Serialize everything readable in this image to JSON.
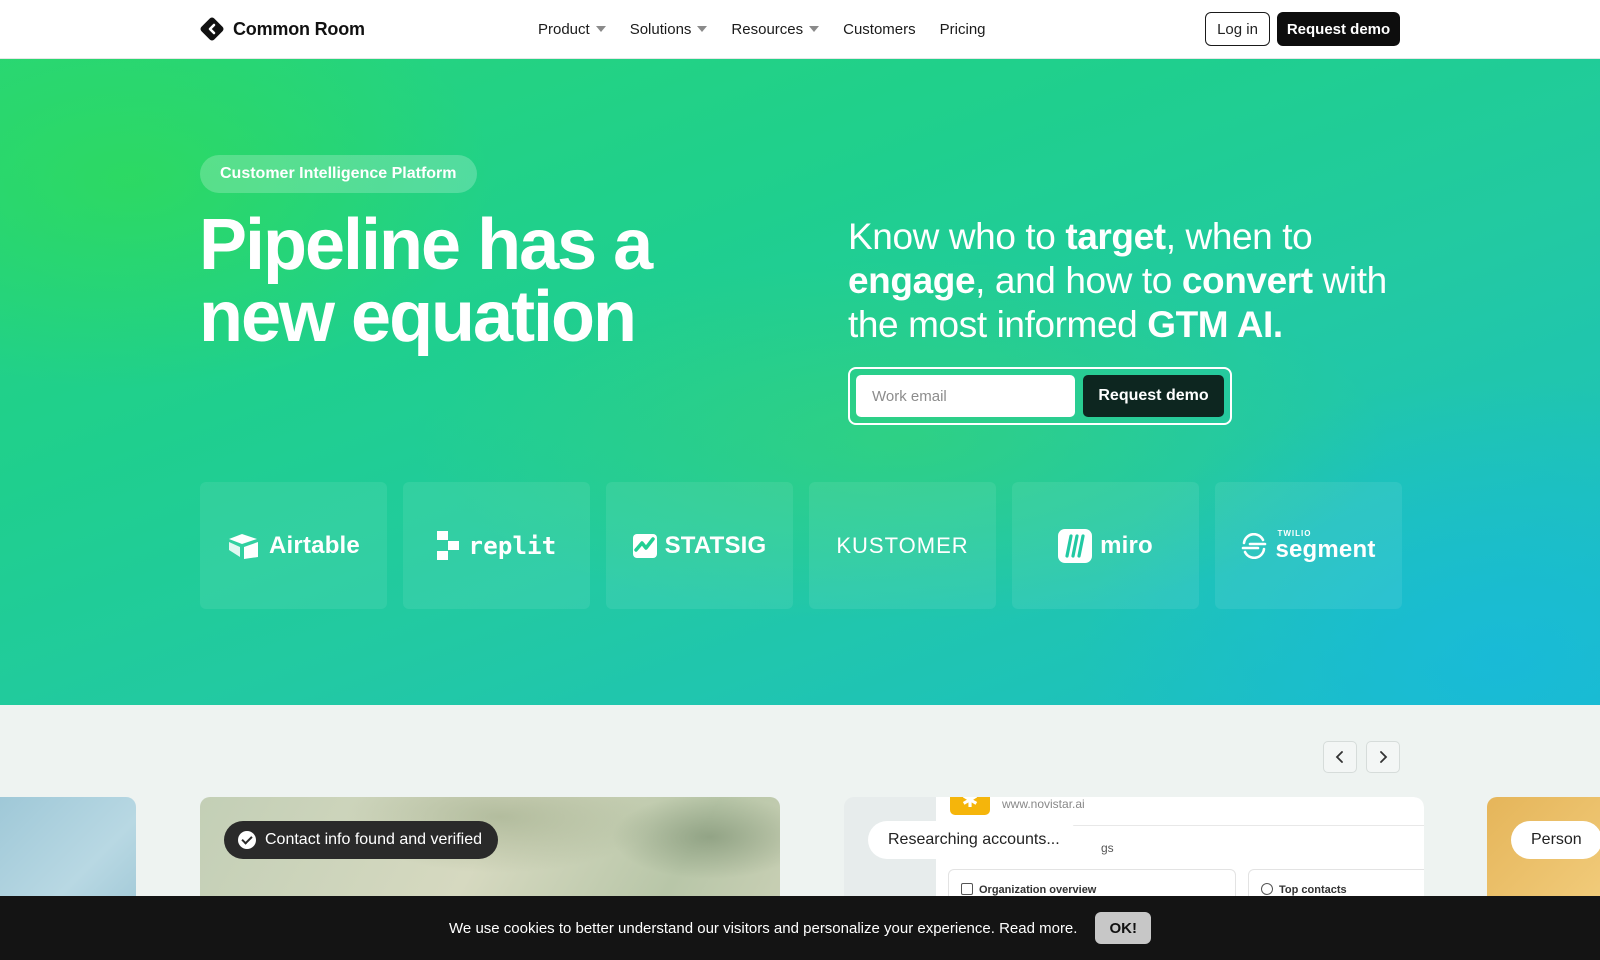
{
  "nav": {
    "brand": "Common Room",
    "items": [
      {
        "label": "Product",
        "has_caret": true
      },
      {
        "label": "Solutions",
        "has_caret": true
      },
      {
        "label": "Resources",
        "has_caret": true
      },
      {
        "label": "Customers",
        "has_caret": false
      },
      {
        "label": "Pricing",
        "has_caret": false
      }
    ],
    "login_label": "Log in",
    "demo_label": "Request demo"
  },
  "hero": {
    "pill": "Customer Intelligence Platform",
    "headline": "Pipeline has a new equation",
    "tagline": {
      "t1": "Know who to ",
      "b1": "target",
      "t2": ", when to ",
      "b2": "engage",
      "t3": ", and how to ",
      "b3": "convert",
      "t4": " with the most informed ",
      "b4": "GTM AI."
    },
    "email_placeholder": "Work email",
    "email_value": "",
    "submit_label": "Request demo"
  },
  "logos": [
    {
      "name": "Airtable",
      "icon": "airtable-icon"
    },
    {
      "name": "replit",
      "icon": "replit-icon"
    },
    {
      "name": "STATSIG",
      "icon": "statsig-icon"
    },
    {
      "name": "KUSTOMER",
      "icon": ""
    },
    {
      "name": "miro",
      "icon": "miro-icon"
    },
    {
      "name": "segment",
      "icon": "segment-icon",
      "super": "TWILIO"
    }
  ],
  "carousel": {
    "prev_icon": "chevron-left-icon",
    "next_icon": "chevron-right-icon",
    "chip_verified": "Contact info found and verified",
    "chip_researching": "Researching accounts...",
    "chip_persona": "Person",
    "mock_url": "www.novistar.ai",
    "mock_partial": "gs",
    "mock_box_1": "Organization overview",
    "mock_box_2": "Top contacts"
  },
  "cookie": {
    "text": "We use cookies to better understand our visitors and personalize your experience. Read more.",
    "ok_label": "OK!"
  },
  "colors": {
    "hero_green": "#27d57a",
    "hero_teal": "#1bbec8",
    "dark_button": "#0d0d0d",
    "form_button": "#0d2620",
    "cookie_bg": "#141414"
  }
}
